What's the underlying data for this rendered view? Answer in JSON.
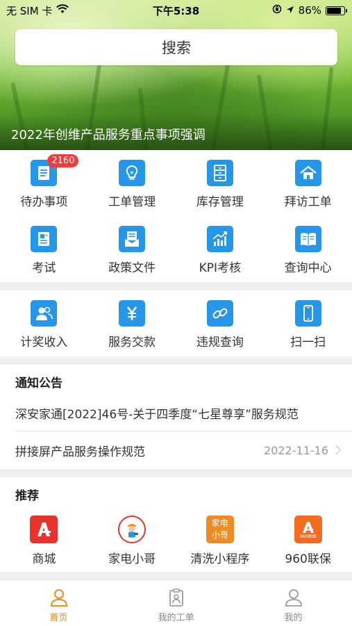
{
  "status_bar": {
    "carrier": "无 SIM 卡",
    "time": "下午5:38",
    "battery": "86%",
    "battery_level": 0.86
  },
  "search": {
    "label": "搜索"
  },
  "banner": {
    "caption": "2022年创维产品服务重点事项强调"
  },
  "grid_main": [
    {
      "label": "待办事项",
      "icon": "todo-list-icon",
      "badge": "2160"
    },
    {
      "label": "工单管理",
      "icon": "lightbulb-icon"
    },
    {
      "label": "库存管理",
      "icon": "cabinet-icon"
    },
    {
      "label": "拜访工单",
      "icon": "house-icon"
    },
    {
      "label": "考试",
      "icon": "exam-paper-icon"
    },
    {
      "label": "政策文件",
      "icon": "policy-doc-icon"
    },
    {
      "label": "KPI考核",
      "icon": "kpi-chart-icon"
    },
    {
      "label": "查询中心",
      "icon": "book-icon"
    }
  ],
  "grid_secondary": [
    {
      "label": "计奖收入",
      "icon": "people-icon"
    },
    {
      "label": "服务交款",
      "icon": "yuan-icon"
    },
    {
      "label": "违规查询",
      "icon": "link-icon"
    },
    {
      "label": "扫一扫",
      "icon": "phone-scan-icon"
    }
  ],
  "notices": {
    "title": "通知公告",
    "items": [
      {
        "text": "深安家通[2022]46号-关于四季度“七星尊享”服务规范",
        "date": ""
      },
      {
        "text": "拼接屏产品服务操作规范",
        "date": "2022-11-16"
      }
    ]
  },
  "recommend": {
    "title": "推荐",
    "items": [
      {
        "label": "商城",
        "icon": "mall-logo-icon"
      },
      {
        "label": "家电小哥",
        "icon": "repairman-icon"
      },
      {
        "label": "清洗小程序",
        "icon": "cleaning-logo-icon",
        "logo_text": "家电小哥"
      },
      {
        "label": "960联保",
        "icon": "warranty-logo-icon",
        "logo_text": "960联保"
      }
    ]
  },
  "tab_bar": [
    {
      "label": "首页",
      "icon": "home-person-icon",
      "active": true
    },
    {
      "label": "我的工单",
      "icon": "clipboard-person-icon",
      "active": false
    },
    {
      "label": "我的",
      "icon": "profile-icon",
      "active": false
    }
  ],
  "colors": {
    "accent": "#2596e8",
    "badge": "#f23b3b",
    "tab_active": "#f08a23",
    "brand_red": "#e8342c"
  }
}
